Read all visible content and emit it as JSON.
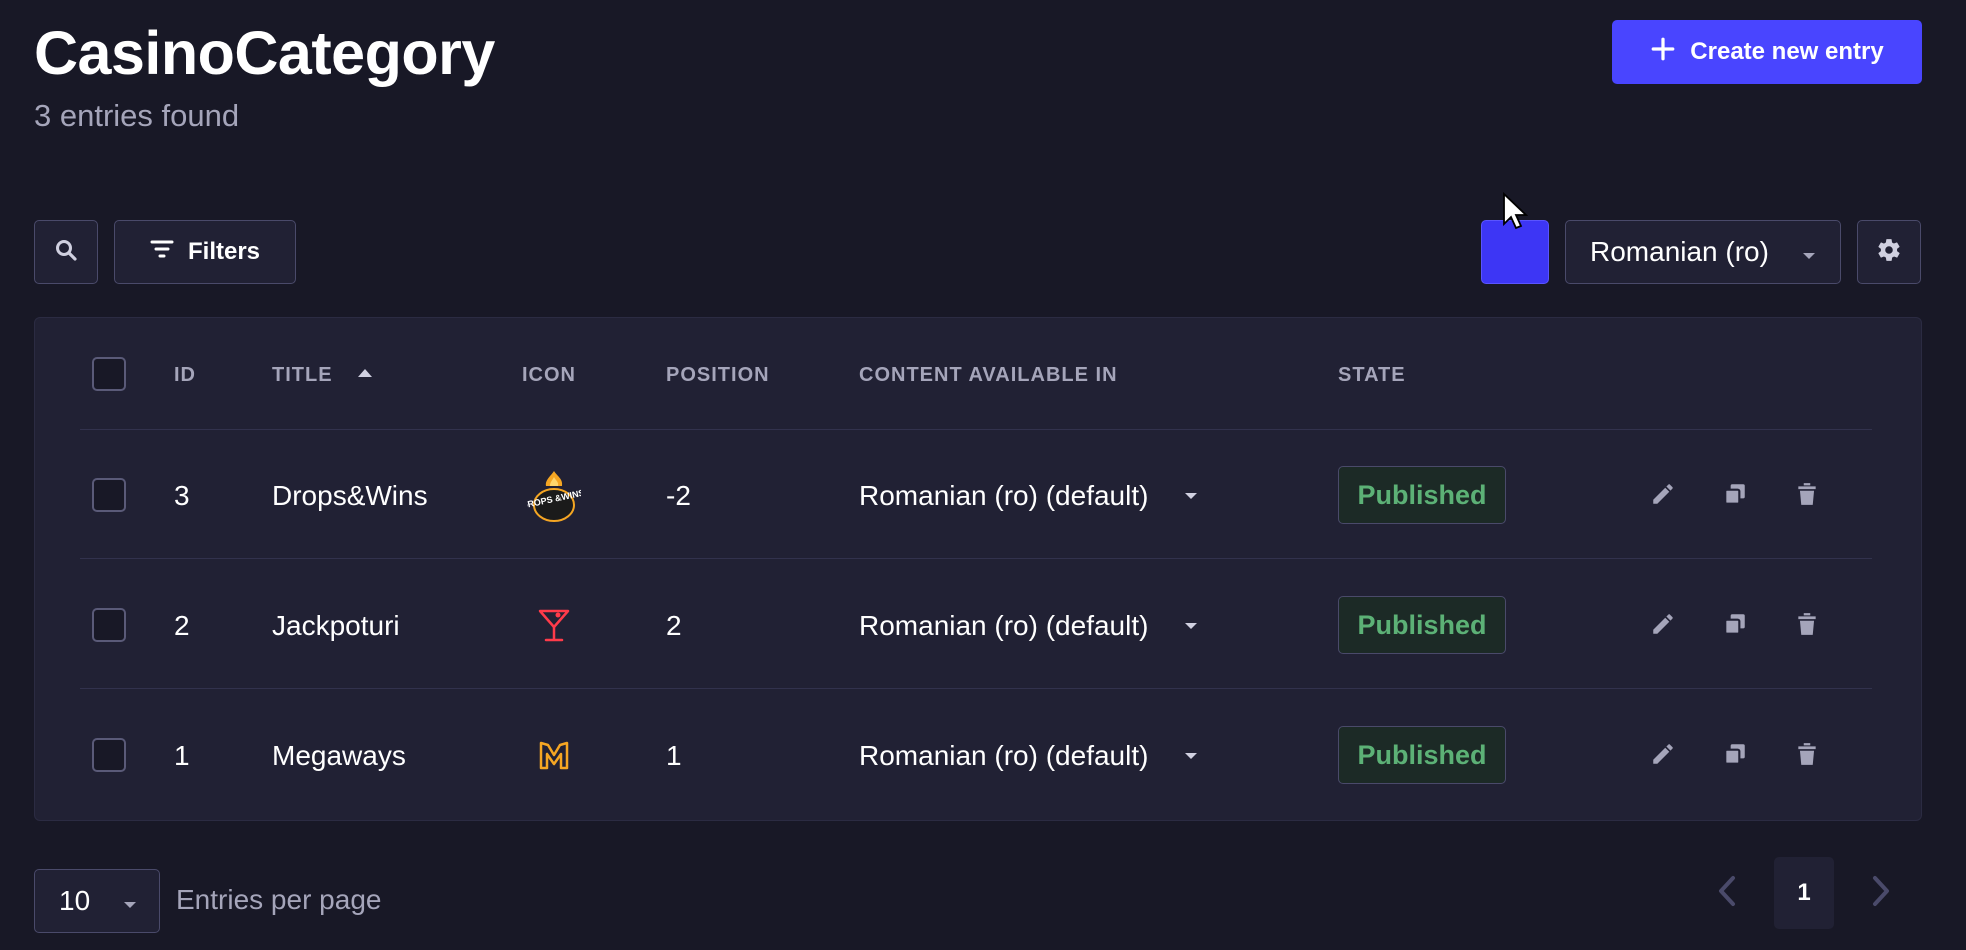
{
  "header": {
    "title": "CasinoCategory",
    "subtitle": "3 entries found",
    "create_label": "Create new entry"
  },
  "toolbar": {
    "filters_label": "Filters",
    "locale_value": "Romanian (ro)",
    "accent_color": "#4945ff"
  },
  "table": {
    "columns": [
      "ID",
      "TITLE",
      "ICON",
      "POSITION",
      "CONTENT AVAILABLE IN",
      "STATE"
    ],
    "sort": {
      "column": "TITLE",
      "direction": "asc"
    },
    "rows": [
      {
        "id": "3",
        "title": "Drops&Wins",
        "icon": "drops-wins-icon",
        "icon_text": "DROPS &WINS",
        "position": "-2",
        "content": "Romanian (ro) (default)",
        "state": "Published"
      },
      {
        "id": "2",
        "title": "Jackpoturi",
        "icon": "cocktail-glass-icon",
        "position": "2",
        "content": "Romanian (ro) (default)",
        "state": "Published"
      },
      {
        "id": "1",
        "title": "Megaways",
        "icon": "megaways-m-icon",
        "position": "1",
        "content": "Romanian (ro) (default)",
        "state": "Published"
      }
    ]
  },
  "footer": {
    "per_page_value": "10",
    "per_page_label": "Entries per page",
    "current_page": "1"
  }
}
